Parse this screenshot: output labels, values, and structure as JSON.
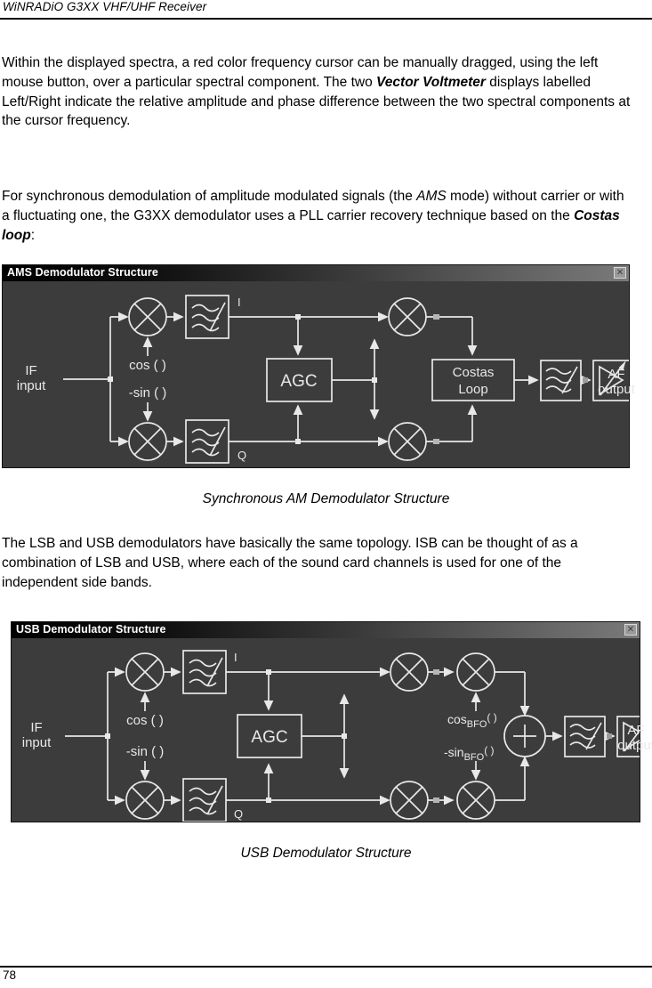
{
  "header": {
    "title": "WiNRADiO G3XX VHF/UHF Receiver"
  },
  "paragraphs": {
    "p1_part1": "Within the displayed spectra, a red color frequency cursor can be manually dragged, using the left mouse button, over a particular spectral component. The two ",
    "p1_bold": "Vector Voltmeter",
    "p1_part2": " displays labelled Left/Right indicate the relative amplitude and phase difference between the two spectral components at the cursor frequency.",
    "p2_part1": "For synchronous demodulation of amplitude modulated signals (the ",
    "p2_italic1": "AMS",
    "p2_part2": " mode) without carrier or with a fluctuating one, the G3XX demodulator uses a PLL carrier recovery technique based on the ",
    "p2_bold": "Costas loop",
    "p2_part3": ":",
    "p3": "The LSB and USB demodulators have basically the same topology. ISB can be thought of as a combination of LSB and USB, where each of the sound card channels is used for one of the independent side bands."
  },
  "figure_ams": {
    "window_title": "AMS Demodulator Structure",
    "close_label": "✕",
    "caption": "Synchronous AM Demodulator Structure",
    "labels": {
      "if_input_line1": "IF",
      "if_input_line2": "input",
      "cos": "cos ( )",
      "neg_sin": "-sin ( )",
      "i": "I",
      "q": "Q",
      "agc": "AGC",
      "costas_line1": "Costas",
      "costas_line2": "Loop",
      "af_output_line1": "AF",
      "af_output_line2": "output"
    },
    "colors": {
      "background": "#3c3c3c",
      "stroke": "#e8e8e8",
      "title_text": "#ffffff"
    }
  },
  "figure_usb": {
    "window_title": "USB Demodulator Structure",
    "close_label": "✕",
    "caption": "USB Demodulator Structure",
    "labels": {
      "if_input_line1": "IF",
      "if_input_line2": "input",
      "cos": "cos ( )",
      "neg_sin": "-sin ( )",
      "i": "I",
      "q": "Q",
      "agc": "AGC",
      "cos_bfo_main": "cos",
      "cos_bfo_sub": "BFO",
      "cos_bfo_paren": "( )",
      "neg_sin_bfo_main": "-sin",
      "neg_sin_bfo_sub": "BFO",
      "neg_sin_bfo_paren": "( )",
      "sum": "+",
      "af_output_line1": "AF",
      "af_output_line2": "output"
    },
    "colors": {
      "background": "#3c3c3c",
      "stroke": "#e8e8e8",
      "title_text": "#ffffff"
    }
  },
  "footer": {
    "page_number": "78"
  }
}
